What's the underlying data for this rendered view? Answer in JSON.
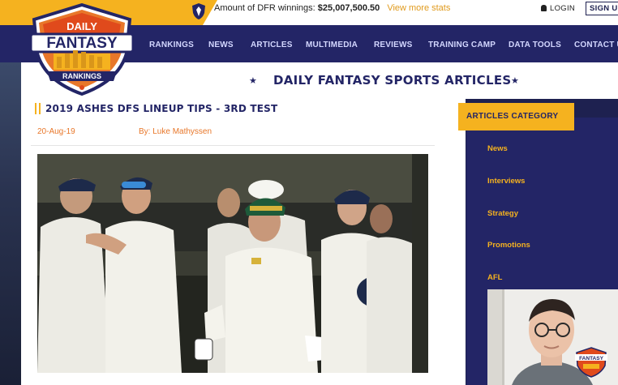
{
  "topbar": {
    "winnings_label": "Amount of DFR winnings:",
    "winnings_amount": "$25,007,500.50",
    "view_more": "View more stats",
    "login": "LOGIN",
    "signup": "SIGN UP"
  },
  "logo": {
    "line1": "DAILY",
    "line2": "FANTASY",
    "line3": "RANKINGS"
  },
  "nav": {
    "items": [
      "RANKINGS",
      "NEWS",
      "ARTICLES",
      "MULTIMEDIA",
      "REVIEWS",
      "TRAINING CAMP",
      "DATA TOOLS",
      "CONTACT US"
    ]
  },
  "page": {
    "title": "DAILY FANTASY SPORTS ARTICLES"
  },
  "article": {
    "title": "2019 ASHES DFS LINEUP TIPS - 3RD TEST",
    "date": "20-Aug-19",
    "author": "By: Luke Mathyssen"
  },
  "sidebar": {
    "heading": "ARTICLES CATEGORY",
    "categories": [
      "News",
      "Interviews",
      "Strategy",
      "Promotions",
      "AFL"
    ]
  },
  "colors": {
    "navy": "#232566",
    "gold": "#f5b21f",
    "orange": "#e8772a"
  },
  "icons": [
    "shield-icon",
    "person-icon",
    "star-icon"
  ]
}
